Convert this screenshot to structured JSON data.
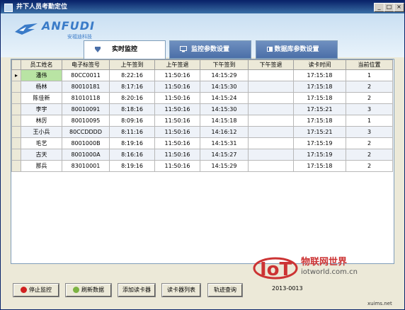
{
  "window": {
    "title": "井下人员考勤定位",
    "min_label": "_",
    "max_label": "□",
    "close_label": "×"
  },
  "logo": {
    "text": "ANFUDI",
    "sub": "安福迪科技"
  },
  "tabs": [
    {
      "label": "实时监控"
    },
    {
      "label": "监控参数设置"
    },
    {
      "label": "数据库参数设置"
    }
  ],
  "table": {
    "headers": [
      "员工姓名",
      "电子标签号",
      "上午签到",
      "上午签退",
      "下午签到",
      "下午签退",
      "读卡时间",
      "当前位置"
    ],
    "rows": [
      [
        "潘伟",
        "80CC0011",
        "8:22:16",
        "11:50:16",
        "14:15:29",
        "",
        "17:15:18",
        "1"
      ],
      [
        "杨林",
        "80010181",
        "8:17:16",
        "11:50:16",
        "14:15:30",
        "",
        "17:15:18",
        "2"
      ],
      [
        "陈佳新",
        "81010118",
        "8:20:16",
        "11:50:16",
        "14:15:24",
        "",
        "17:15:18",
        "2"
      ],
      [
        "李宇",
        "80010091",
        "8:18:16",
        "11:50:16",
        "14:15:30",
        "",
        "17:15:21",
        "3"
      ],
      [
        "林厉",
        "80010095",
        "8:09:16",
        "11:50:16",
        "14:15:18",
        "",
        "17:15:18",
        "1"
      ],
      [
        "王小兵",
        "80CCDDDD",
        "8:11:16",
        "11:50:16",
        "14:16:12",
        "",
        "17:15:21",
        "3"
      ],
      [
        "毛艺",
        "8001000B",
        "8:19:16",
        "11:50:16",
        "14:15:31",
        "",
        "17:15:19",
        "2"
      ],
      [
        "古天",
        "8001000A",
        "8:16:16",
        "11:50:16",
        "14:15:27",
        "",
        "17:15:19",
        "2"
      ],
      [
        "那兵",
        "83010001",
        "8:19:16",
        "11:50:16",
        "14:15:29",
        "",
        "17:15:18",
        "2"
      ]
    ]
  },
  "buttons": {
    "stop": "停止监控",
    "refresh": "刷新数据",
    "add_reader": "添加读卡器",
    "reader_list": "读卡器列表",
    "track_query": "轨迹查询"
  },
  "status": {
    "date": "2013-0013"
  },
  "watermark": {
    "cn": "物联网世界",
    "en": "iotworld.com.cn",
    "corner": "xuims.net"
  },
  "colors": {
    "title_bar": "#0a246a",
    "tab_inactive": "#4b6fa8",
    "selected_name": "#b9e4a4",
    "logo": "#3a7bc8",
    "watermark": "#cc3333"
  }
}
